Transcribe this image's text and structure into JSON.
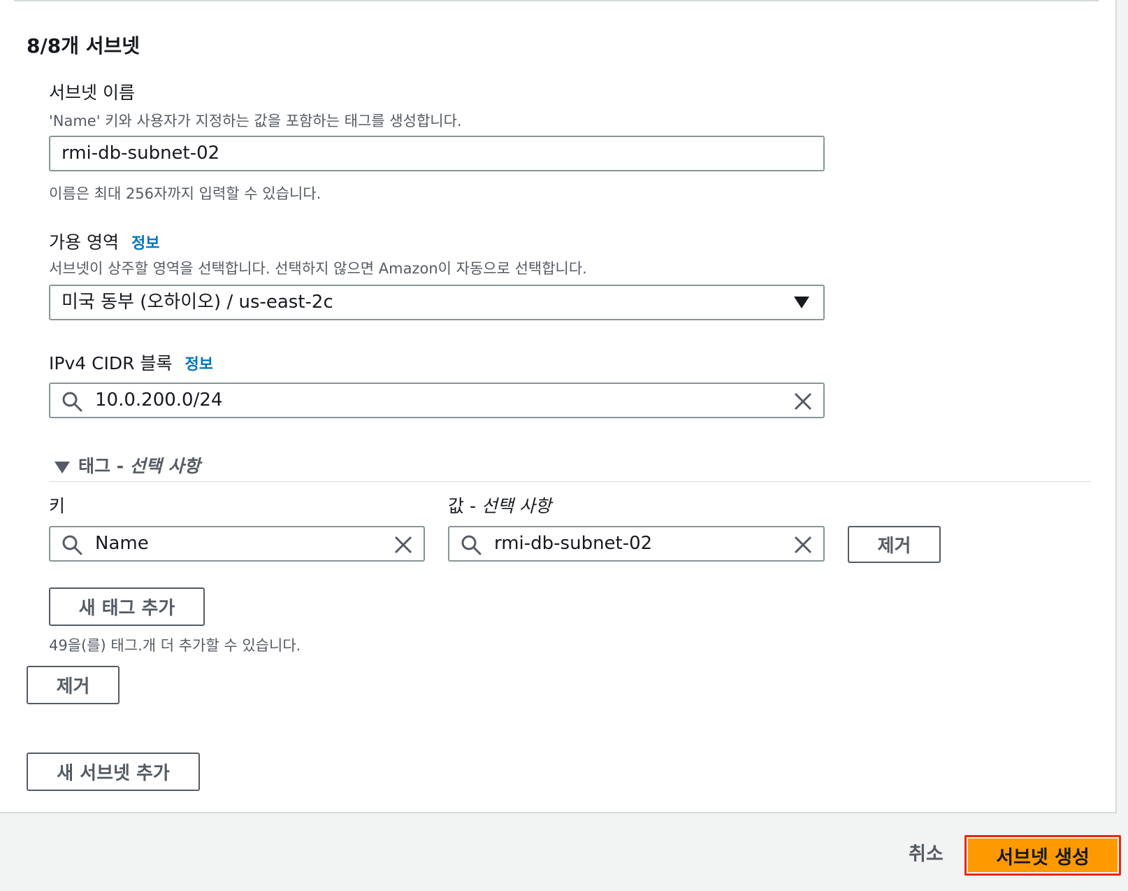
{
  "section_title": "8/8개 서브넷",
  "subnet_name": {
    "label": "서브넷 이름",
    "description": "'Name' 키와 사용자가 지정하는 값을 포함하는 태그를 생성합니다.",
    "value": "rmi-db-subnet-02",
    "hint": "이름은 최대 256자까지 입력할 수 있습니다."
  },
  "availability_zone": {
    "label": "가용 영역",
    "info": "정보",
    "description": "서브넷이 상주할 영역을 선택합니다. 선택하지 않으면 Amazon이 자동으로 선택합니다.",
    "selected": "미국 동부 (오하이오) / us-east-2c"
  },
  "cidr": {
    "label": "IPv4 CIDR 블록",
    "info": "정보",
    "value": "10.0.200.0/24"
  },
  "tags": {
    "header_main": "태그 - ",
    "header_optional": "선택 사항",
    "key_label": "키",
    "value_label_main": "값 - ",
    "value_label_optional": "선택 사항",
    "key_value": "Name",
    "value_value": "rmi-db-subnet-02",
    "remove_label": "제거",
    "add_tag_label": "새 태그 추가",
    "remaining_text": "49을(를) 태그.개 더 추가할 수 있습니다."
  },
  "remove_subnet_label": "제거",
  "add_subnet_label": "새 서브넷 추가",
  "footer": {
    "cancel_label": "취소",
    "create_label": "서브넷 생성"
  },
  "colors": {
    "primary_button": "#ff9900",
    "highlight_outline": "#e8290b",
    "link": "#0073bb",
    "border": "#879596"
  }
}
